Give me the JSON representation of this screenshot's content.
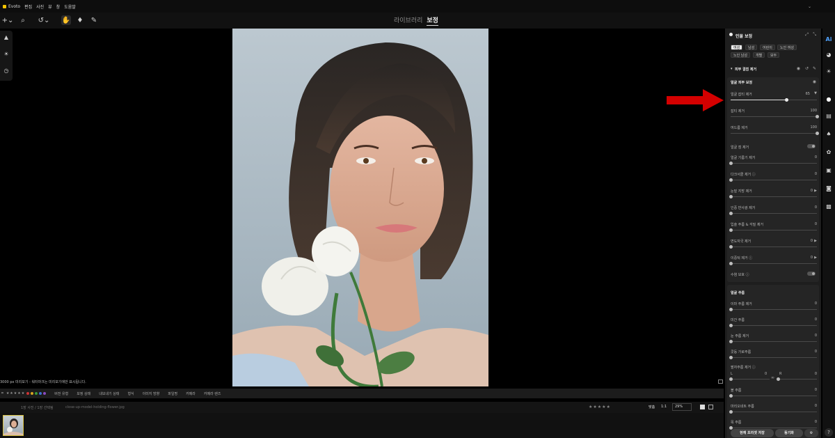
{
  "menubar": {
    "app": "Evoto",
    "items": [
      "편집",
      "사진",
      "뷰",
      "창",
      "도움말"
    ]
  },
  "modes": {
    "library": "라이브러리",
    "retouch": "보정"
  },
  "status_text": "3000 px 미리보기 - 워터마크는 미리보기에만 표시됩니다.",
  "filterbar": {
    "items": [
      "버전 유형",
      "보정 상태",
      "내보내기 상태",
      "형식",
      "이미지 방향",
      "파일명",
      "카메라",
      "카메라 렌즈"
    ]
  },
  "infobar": {
    "count": "1장 사진 / 1장 선택됨",
    "filename": "close-up-model-holding-flower.jpg",
    "fit": "맞춤",
    "one_to_one": "1:1",
    "zoom": "29%"
  },
  "panel": {
    "title": "인물 보정",
    "chips": [
      "여성",
      "남성",
      "어린이",
      "노인 여성",
      "노인 남성",
      "개별",
      "모두"
    ],
    "selected_chip": "여성",
    "section": "피부 결점 제거",
    "subsection": "얼굴 피부 보정",
    "sliders_top": [
      {
        "label": "얼굴 잡티 제거",
        "value": "65",
        "fraction": 0.65
      },
      {
        "label": "잡티 제거",
        "value": "100",
        "fraction": 1.0
      },
      {
        "label": "여드름 제거",
        "value": "100",
        "fraction": 1.0
      }
    ],
    "mole_toggle": "얼굴 점 제거",
    "sliders_mid": [
      {
        "label": "얼굴 기름기 제거",
        "value": "0"
      },
      {
        "label": "다크서클 제거 ⓘ",
        "value": "0"
      },
      {
        "label": "눈밑 지방 제거",
        "value": "0"
      },
      {
        "label": "인중 반사광 제거",
        "value": "0"
      },
      {
        "label": "입술 주름 & 각질 제거",
        "value": "0"
      },
      {
        "label": "면도자국 제거",
        "value": "0"
      },
      {
        "label": "이중턱 제거 ⓘ",
        "value": "0"
      }
    ],
    "beard_toggle": "수염 보호 ⓘ",
    "wrinkle_section": "얼굴 주름",
    "sliders_wrinkle": [
      {
        "label": "이마 주름 제거",
        "value": "0"
      },
      {
        "label": "미간 주름",
        "value": "0"
      },
      {
        "label": "눈 주름 제거",
        "value": "0"
      },
      {
        "label": "콧등 가로주름",
        "value": "0"
      }
    ],
    "nasolabial": {
      "label": "팔자주름 제거 ⓘ",
      "l_label": "L",
      "l_value": "0",
      "r_label": "R",
      "r_value": "0"
    },
    "sliders_wrinkle2": [
      {
        "label": "볼 주름",
        "value": "0"
      },
      {
        "label": "마리오네트 주름",
        "value": "0"
      },
      {
        "label": "목 주름",
        "value": "0"
      }
    ],
    "save_preset": "현재 프리셋 저장",
    "sync": "동기화"
  },
  "colors": {
    "accent_arrow": "#d40000",
    "selection": "#d8c040",
    "ai_icon": "#4fa3ff"
  }
}
